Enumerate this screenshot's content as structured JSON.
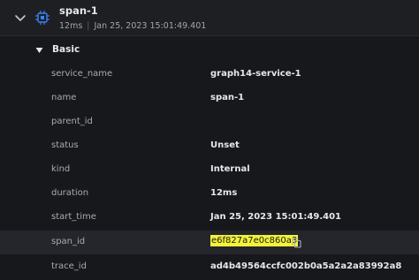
{
  "span": {
    "name": "span-1",
    "duration": "12ms",
    "separator": "|",
    "timestamp": "Jan 25, 2023 15:01:49.401",
    "chevron_icon": "chevron-down-icon",
    "type_icon": "chip-icon"
  },
  "section": {
    "title": "Basic",
    "icon": "caret-down-icon"
  },
  "attributes": [
    {
      "key": "service_name",
      "value": "graph14-service-1"
    },
    {
      "key": "name",
      "value": "span-1"
    },
    {
      "key": "parent_id",
      "value": ""
    },
    {
      "key": "status",
      "value": "Unset"
    },
    {
      "key": "kind",
      "value": "Internal"
    },
    {
      "key": "duration",
      "value": "12ms"
    },
    {
      "key": "start_time",
      "value": "Jan 25, 2023 15:01:49.401"
    },
    {
      "key": "span_id",
      "value": "e6f827a7e0c860a3",
      "highlighted": true,
      "copy_icon": "copy-icon"
    },
    {
      "key": "trace_id",
      "value": "ad4b49564ccfc002b0a5a2a2a83992a8"
    }
  ],
  "colors": {
    "background": "#17181b",
    "header_background": "#1e1f23",
    "highlight": "#f3f33a",
    "accent_icon": "#3b82f6"
  }
}
